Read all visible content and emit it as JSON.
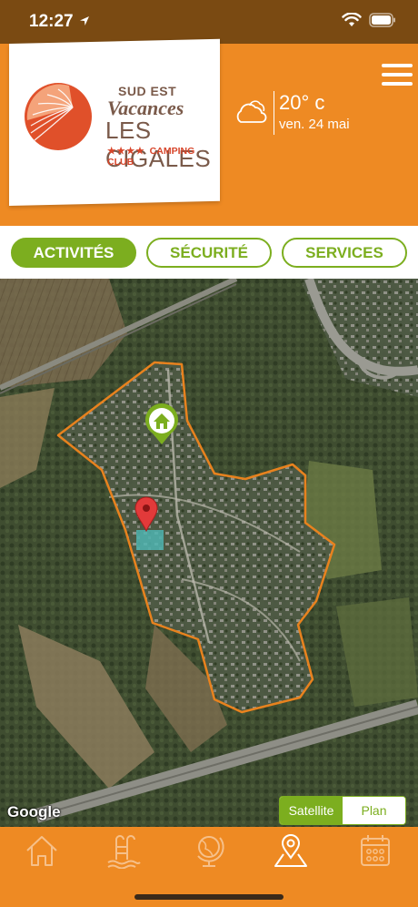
{
  "status_bar": {
    "time": "12:27"
  },
  "header": {
    "brand": {
      "top": "SUD EST",
      "script": "Vacances",
      "name": "LES CIGALES",
      "stars": "★★★★",
      "sub": "CAMPING CLUB"
    },
    "weather": {
      "icon": "cloud-icon",
      "temperature": "20° c",
      "date": "ven. 24 mai"
    },
    "menu_icon": "hamburger-menu-icon"
  },
  "tabs": [
    {
      "label": "ACTIVITÉS",
      "active": true
    },
    {
      "label": "SÉCURITÉ",
      "active": false
    },
    {
      "label": "SERVICES",
      "active": false
    }
  ],
  "map": {
    "attribution": "Google",
    "toggle": {
      "satellite": "Satellite",
      "plan": "Plan",
      "selected": "Satellite"
    },
    "markers": [
      "home-marker-icon",
      "red-location-pin-icon"
    ]
  },
  "bottom_nav": {
    "items": [
      "home-icon",
      "pool-ladder-icon",
      "globe-icon",
      "map-pin-icon",
      "calendar-icon"
    ],
    "active": "map-pin-icon"
  },
  "colors": {
    "brand_orange": "#ee8a23",
    "accent_green": "#7cae1f",
    "status_bar": "#7a4a12",
    "boundary_orange": "#e8821e"
  }
}
